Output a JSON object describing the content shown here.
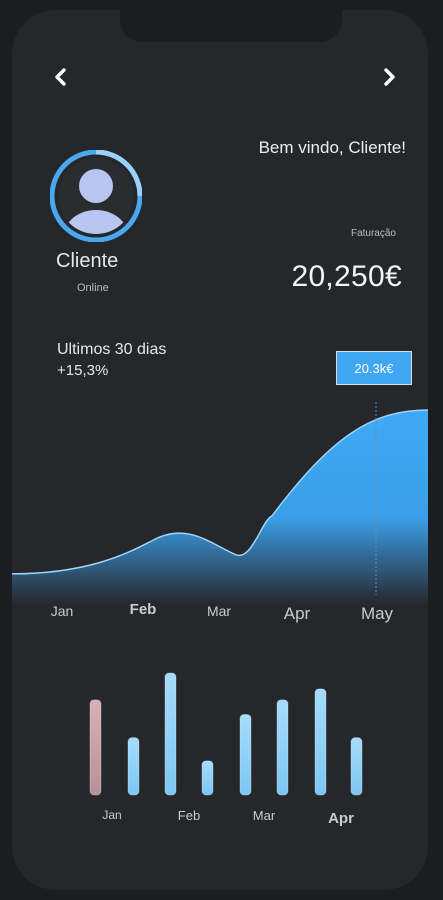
{
  "header": {
    "welcome": "Bem vindo, Cliente!",
    "back_icon": "chevron-left-icon",
    "forward_icon": "chevron-right-icon"
  },
  "profile": {
    "name": "Cliente",
    "status": "Online",
    "avatar_icon": "user-avatar-icon"
  },
  "revenue": {
    "label": "Faturação",
    "value": "20,250€"
  },
  "period": {
    "title": "Ultimos 30 dias",
    "change": "+15,3%"
  },
  "tooltip": {
    "text": "20.3k€"
  },
  "colors": {
    "background": "#26272b",
    "accent": "#3ea6f2",
    "bar_pink": "#c9a0a6",
    "bar_blue": "#8fd0f4"
  },
  "chart_data": [
    {
      "type": "area",
      "categories": [
        "Jan",
        "Feb",
        "Mar",
        "Apr",
        "May"
      ],
      "values": [
        0.5,
        4.5,
        2.8,
        7.5,
        20.3
      ],
      "title": "",
      "xlabel": "",
      "ylabel": "",
      "grid": false,
      "highlight": {
        "category": "May",
        "label": "20.3k€"
      }
    },
    {
      "type": "bar",
      "categories": [
        "Jan",
        "Feb",
        "Mar",
        "Apr"
      ],
      "values": [
        0.78,
        0.47,
        1.0,
        0.28,
        0.66,
        0.78,
        0.87,
        0.47
      ],
      "series": [
        {
          "values": [
            0.78,
            0.47,
            1.0,
            0.28,
            0.66,
            0.78,
            0.87,
            0.47
          ]
        }
      ],
      "title": "",
      "xlabel": "",
      "ylabel": ""
    }
  ]
}
